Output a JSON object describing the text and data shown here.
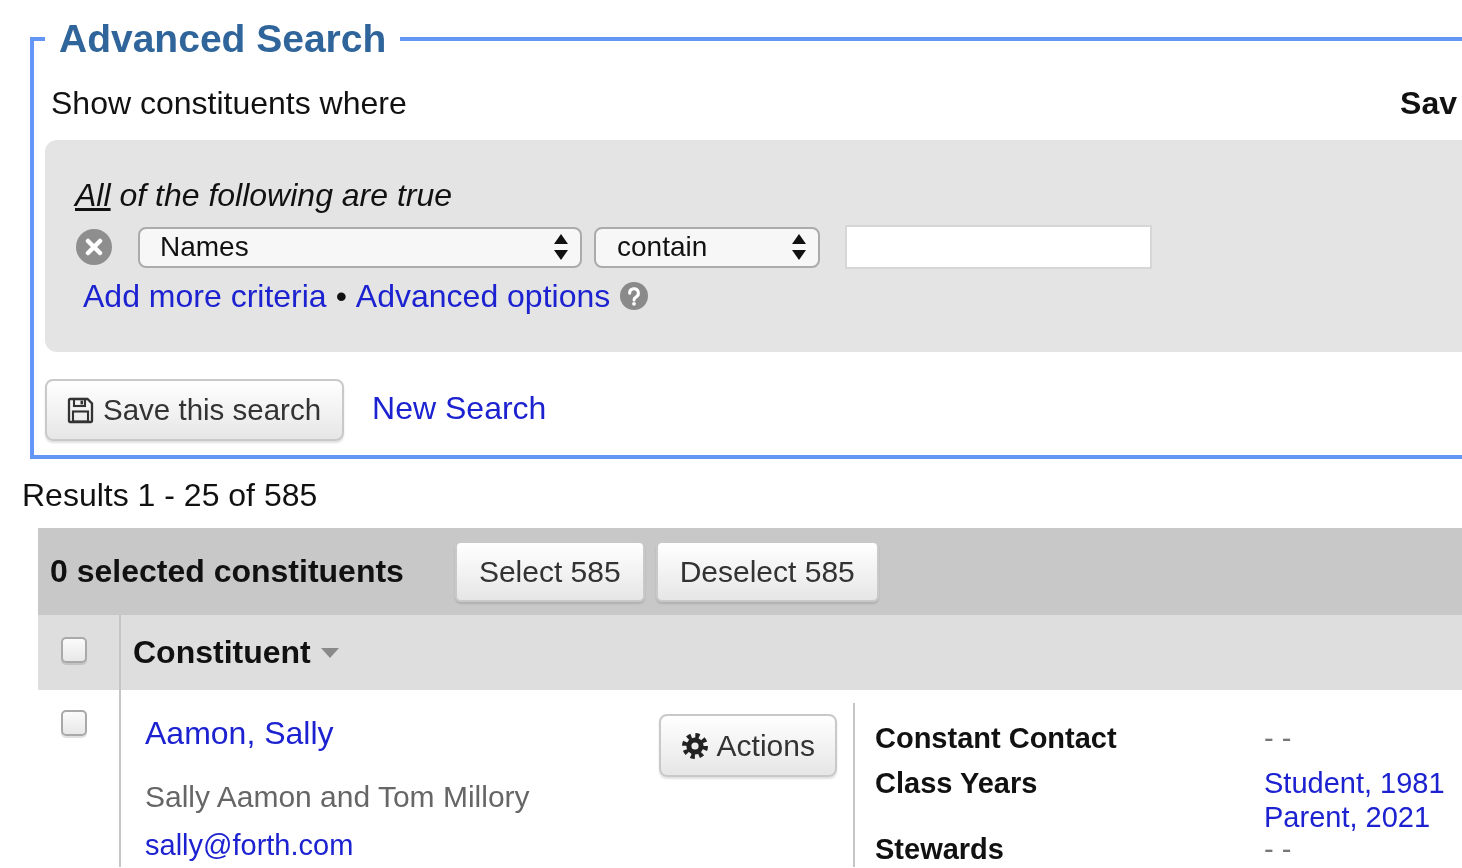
{
  "search_panel": {
    "title": "Advanced Search",
    "intro": "Show constituents where",
    "cut_off_label": "Sav",
    "criteria": {
      "match_link": "All",
      "heading": "of the following are true",
      "rows": [
        {
          "field": "Names",
          "operator": "contain"
        }
      ],
      "separator": "•",
      "links": [
        {
          "text": "Add more criteria",
          "help": false
        },
        {
          "text": "Advanced options",
          "help": true
        }
      ]
    },
    "save_button": "Save this search",
    "new_search_link": "New Search"
  },
  "results_summary": "Results 1 - 25 of 585",
  "selection_bar": {
    "count_label": "0 selected constituents",
    "buttons": [
      "Select 585",
      "Deselect 585"
    ]
  },
  "table": {
    "header": {
      "checked": false,
      "column": "Constituent"
    },
    "rows": [
      {
        "checked": false,
        "name": "Aamon, Sally",
        "description": "Sally Aamon and Tom Millory",
        "email": "sally@forth.com",
        "actions_button": "Actions",
        "fields": [
          {
            "label": "Constant Contact",
            "values": [
              {
                "kind": "empty",
                "text": "- -"
              }
            ]
          },
          {
            "label": "Class Years",
            "values": [
              {
                "kind": "link",
                "text": "Student, 1981"
              },
              {
                "kind": "link",
                "text": "Parent, 2021"
              }
            ]
          },
          {
            "label": "Stewards",
            "values": [
              {
                "kind": "empty",
                "text": "- -"
              }
            ]
          }
        ]
      }
    ]
  }
}
